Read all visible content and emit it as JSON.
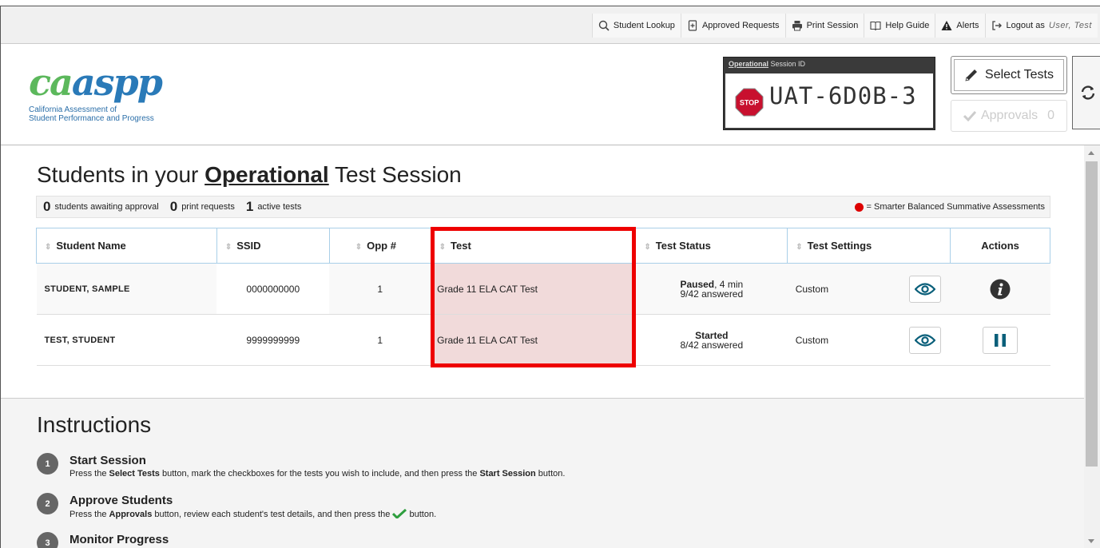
{
  "topnav": {
    "student_lookup": "Student Lookup",
    "approved_requests": "Approved Requests",
    "print_session": "Print Session",
    "help_guide": "Help Guide",
    "alerts": "Alerts",
    "logout_prefix": "Logout as",
    "logout_user": "User, Test"
  },
  "logo": {
    "mark_ca": "ca",
    "mark_aspp": "aspp",
    "subtitle_line1": "California Assessment of",
    "subtitle_line2": "Student Performance and Progress"
  },
  "session": {
    "label_bold": "Operational",
    "label_rest": " Session ID",
    "stop_text": "STOP",
    "id": "UAT-6D0B-3"
  },
  "buttons": {
    "select_tests": "Select Tests",
    "approvals": "Approvals",
    "approvals_count": "0"
  },
  "page": {
    "title_pre": "Students in your ",
    "title_bold": "Operational",
    "title_post": " Test Session"
  },
  "summary": {
    "awaiting_count": "0",
    "awaiting_label": "students awaiting approval",
    "print_count": "0",
    "print_label": "print requests",
    "active_count": "1",
    "active_label": "active tests",
    "legend_text": "= Smarter Balanced Summative Assessments"
  },
  "table": {
    "headers": {
      "name": "Student Name",
      "ssid": "SSID",
      "opp": "Opp #",
      "test": "Test",
      "status": "Test Status",
      "settings": "Test Settings",
      "actions": "Actions"
    },
    "rows": [
      {
        "name": "STUDENT, SAMPLE",
        "ssid": "0000000000",
        "opp": "1",
        "test": "Grade 11 ELA CAT Test",
        "status_bold": "Paused",
        "status_extra": ", 4 min",
        "answered": "9/42 answered",
        "settings": "Custom"
      },
      {
        "name": "TEST, STUDENT",
        "ssid": "9999999999",
        "opp": "1",
        "test": "Grade 11 ELA CAT Test",
        "status_bold": "Started",
        "status_extra": "",
        "answered": "8/42 answered",
        "settings": "Custom"
      }
    ]
  },
  "instructions": {
    "title": "Instructions",
    "steps": [
      {
        "num": "1",
        "title": "Start Session",
        "d1": "Press the ",
        "b1": "Select Tests",
        "d2": " button, mark the checkboxes for the tests you wish to include, and then press the ",
        "b2": "Start Session",
        "d3": " button."
      },
      {
        "num": "2",
        "title": "Approve Students",
        "d1": "Press the ",
        "b1": "Approvals",
        "d2": " button, review each student's test details, and then press the ",
        "d3": " button."
      },
      {
        "num": "3",
        "title": "Monitor Progress"
      }
    ]
  },
  "colors": {
    "highlight": "#e00000",
    "test_cell_bg": "#f1dada",
    "legend_dot": "#dd0000",
    "check": "#2e9e3e"
  }
}
